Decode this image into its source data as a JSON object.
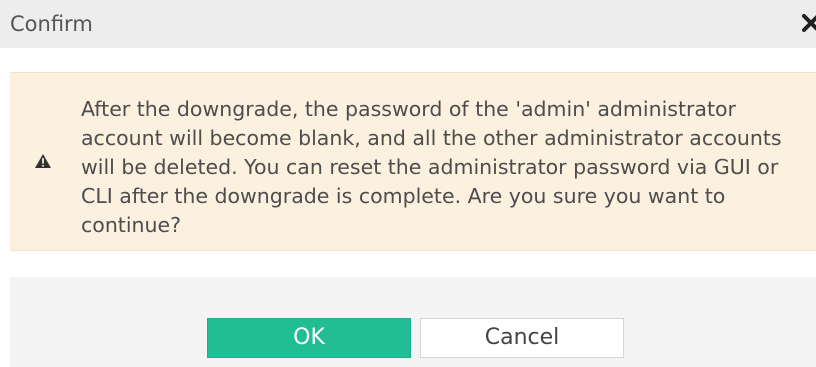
{
  "dialog": {
    "title": "Confirm",
    "close_icon": "close-icon",
    "warning_icon": "warning-icon",
    "message": "After the downgrade, the password of the 'admin' administrator account will become blank, and all the other administrator accounts will be deleted. You can reset the administrator password via GUI or CLI after the downgrade is complete. Are you sure you want to continue?",
    "ok_label": "OK",
    "cancel_label": "Cancel"
  },
  "colors": {
    "title_bar": "#ededed",
    "warning_background": "#fcf0df",
    "ok_button": "#21bd94",
    "footer": "#f4f4f4"
  }
}
